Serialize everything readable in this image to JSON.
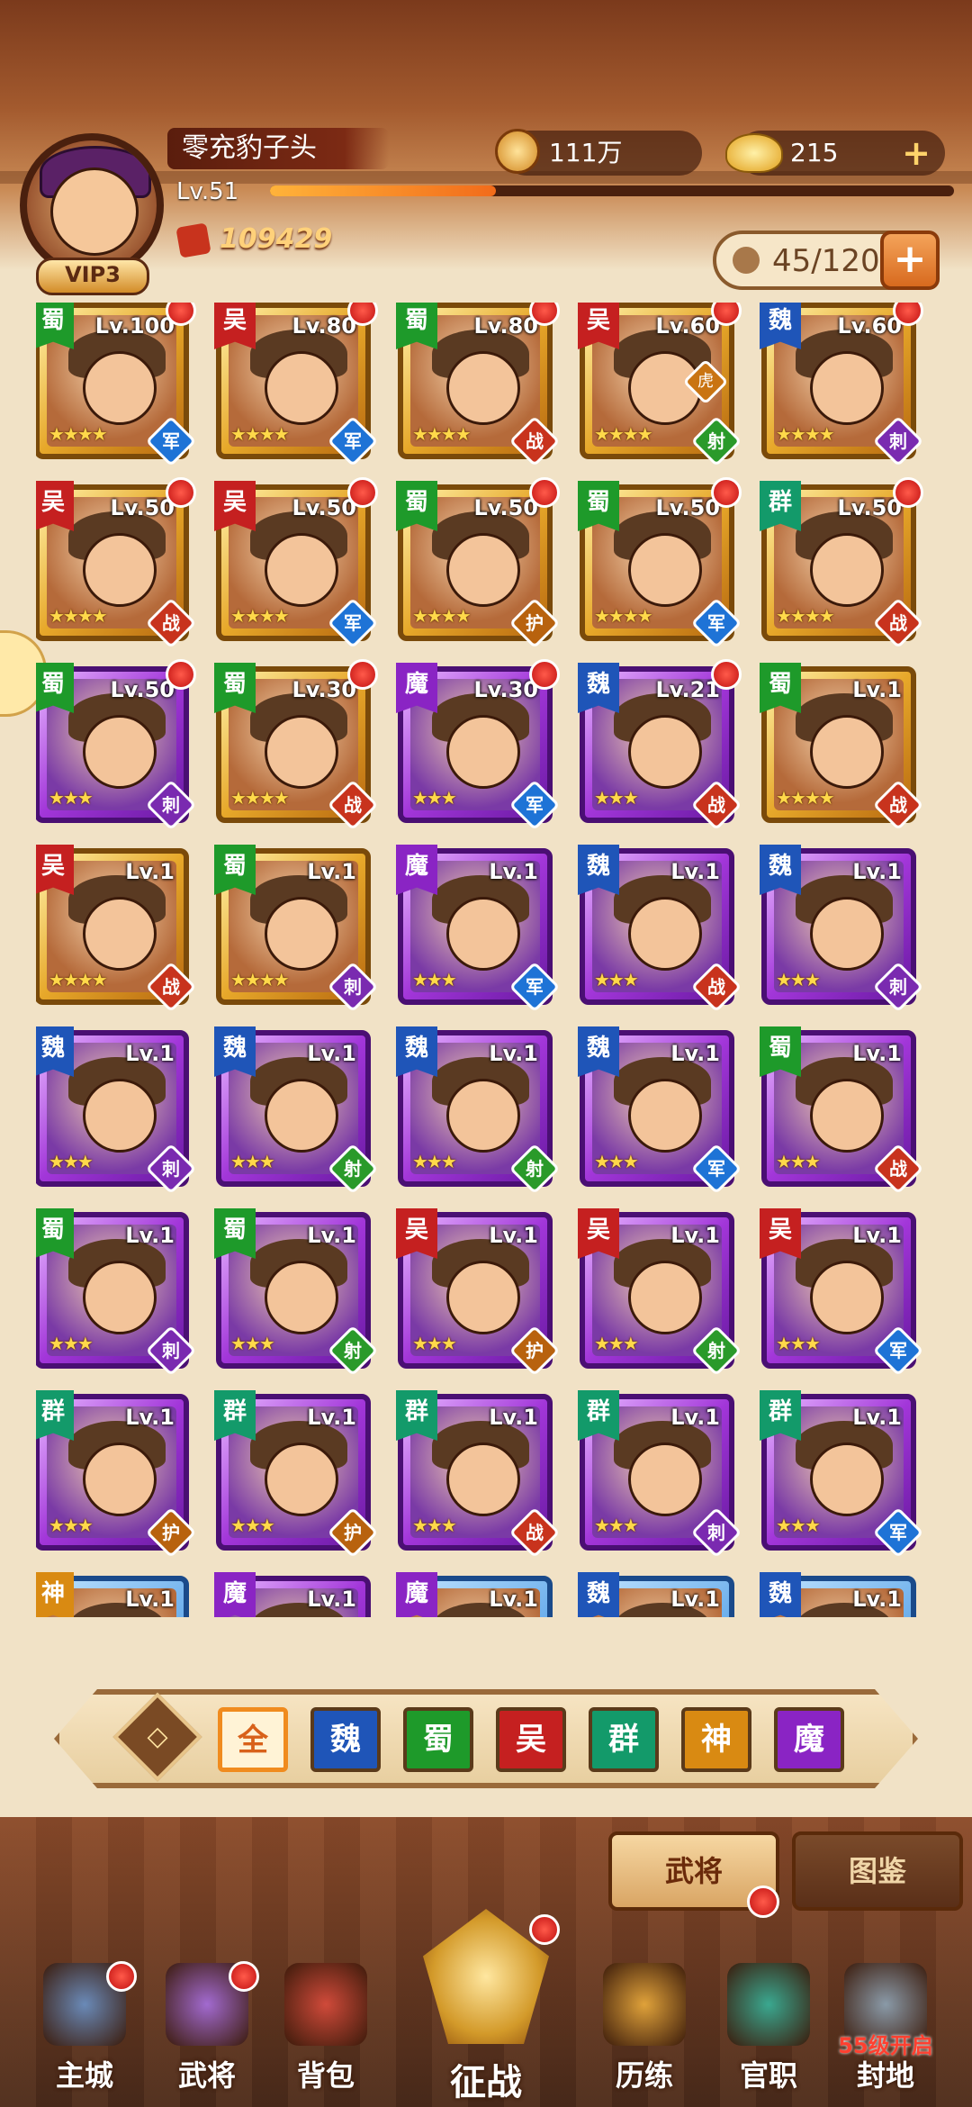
{
  "player": {
    "name": "零充豹子头",
    "level": "Lv.51",
    "vip": "VIP3",
    "power": "109429",
    "exp_fraction": 0.33
  },
  "resources": {
    "coins": "111万",
    "gold": "215"
  },
  "hero_count": "45/120",
  "heroes": [
    {
      "faction": "蜀",
      "level": "Lv.100",
      "stars": "★★★★",
      "role": "军",
      "rarity": "gold",
      "dot": true
    },
    {
      "faction": "吴",
      "level": "Lv.80",
      "stars": "★★★★",
      "role": "军",
      "rarity": "gold",
      "dot": true
    },
    {
      "faction": "蜀",
      "level": "Lv.80",
      "stars": "★★★★",
      "role": "战",
      "rarity": "gold",
      "dot": true
    },
    {
      "faction": "吴",
      "level": "Lv.60",
      "stars": "★★★★",
      "role": "射",
      "extra_role": "虎",
      "rarity": "gold",
      "dot": true
    },
    {
      "faction": "魏",
      "level": "Lv.60",
      "stars": "★★★★",
      "role": "刺",
      "rarity": "gold",
      "dot": true
    },
    {
      "faction": "吴",
      "level": "Lv.50",
      "stars": "★★★★",
      "role": "战",
      "rarity": "gold",
      "dot": true
    },
    {
      "faction": "吴",
      "level": "Lv.50",
      "stars": "★★★★",
      "role": "军",
      "rarity": "gold",
      "dot": true
    },
    {
      "faction": "蜀",
      "level": "Lv.50",
      "stars": "★★★★",
      "role": "护",
      "rarity": "gold",
      "dot": true
    },
    {
      "faction": "蜀",
      "level": "Lv.50",
      "stars": "★★★★",
      "role": "军",
      "rarity": "gold",
      "dot": true
    },
    {
      "faction": "群",
      "level": "Lv.50",
      "stars": "★★★★",
      "role": "战",
      "rarity": "gold",
      "dot": true
    },
    {
      "faction": "蜀",
      "level": "Lv.50",
      "stars": "★★★",
      "role": "刺",
      "rarity": "purple",
      "dot": true
    },
    {
      "faction": "蜀",
      "level": "Lv.30",
      "stars": "★★★★",
      "role": "战",
      "rarity": "gold",
      "dot": true
    },
    {
      "faction": "魔",
      "level": "Lv.30",
      "stars": "★★★",
      "role": "军",
      "rarity": "purple",
      "dot": true
    },
    {
      "faction": "魏",
      "level": "Lv.21",
      "stars": "★★★",
      "role": "战",
      "rarity": "purple",
      "dot": true
    },
    {
      "faction": "蜀",
      "level": "Lv.1",
      "stars": "★★★★",
      "role": "战",
      "rarity": "gold",
      "dot": false
    },
    {
      "faction": "吴",
      "level": "Lv.1",
      "stars": "★★★★",
      "role": "战",
      "rarity": "gold",
      "dot": false
    },
    {
      "faction": "蜀",
      "level": "Lv.1",
      "stars": "★★★★",
      "role": "刺",
      "rarity": "gold",
      "dot": false
    },
    {
      "faction": "魔",
      "level": "Lv.1",
      "stars": "★★★",
      "role": "军",
      "rarity": "purple",
      "dot": false
    },
    {
      "faction": "魏",
      "level": "Lv.1",
      "stars": "★★★",
      "role": "战",
      "rarity": "purple",
      "dot": false
    },
    {
      "faction": "魏",
      "level": "Lv.1",
      "stars": "★★★",
      "role": "刺",
      "rarity": "purple",
      "dot": false
    },
    {
      "faction": "魏",
      "level": "Lv.1",
      "stars": "★★★",
      "role": "刺",
      "rarity": "purple",
      "dot": false
    },
    {
      "faction": "魏",
      "level": "Lv.1",
      "stars": "★★★",
      "role": "射",
      "rarity": "purple",
      "dot": false
    },
    {
      "faction": "魏",
      "level": "Lv.1",
      "stars": "★★★",
      "role": "射",
      "rarity": "purple",
      "dot": false
    },
    {
      "faction": "魏",
      "level": "Lv.1",
      "stars": "★★★",
      "role": "军",
      "rarity": "purple",
      "dot": false
    },
    {
      "faction": "蜀",
      "level": "Lv.1",
      "stars": "★★★",
      "role": "战",
      "rarity": "purple",
      "dot": false
    },
    {
      "faction": "蜀",
      "level": "Lv.1",
      "stars": "★★★",
      "role": "刺",
      "rarity": "purple",
      "dot": false
    },
    {
      "faction": "蜀",
      "level": "Lv.1",
      "stars": "★★★",
      "role": "射",
      "rarity": "purple",
      "dot": false
    },
    {
      "faction": "吴",
      "level": "Lv.1",
      "stars": "★★★",
      "role": "护",
      "rarity": "purple",
      "dot": false
    },
    {
      "faction": "吴",
      "level": "Lv.1",
      "stars": "★★★",
      "role": "射",
      "rarity": "purple",
      "dot": false
    },
    {
      "faction": "吴",
      "level": "Lv.1",
      "stars": "★★★",
      "role": "军",
      "rarity": "purple",
      "dot": false
    },
    {
      "faction": "群",
      "level": "Lv.1",
      "stars": "★★★",
      "role": "护",
      "rarity": "purple",
      "dot": false
    },
    {
      "faction": "群",
      "level": "Lv.1",
      "stars": "★★★",
      "role": "护",
      "rarity": "purple",
      "dot": false
    },
    {
      "faction": "群",
      "level": "Lv.1",
      "stars": "★★★",
      "role": "战",
      "rarity": "purple",
      "dot": false
    },
    {
      "faction": "群",
      "level": "Lv.1",
      "stars": "★★★",
      "role": "刺",
      "rarity": "purple",
      "dot": false
    },
    {
      "faction": "群",
      "level": "Lv.1",
      "stars": "★★★",
      "role": "军",
      "rarity": "purple",
      "dot": false
    },
    {
      "faction": "神",
      "level": "Lv.1",
      "stars": "",
      "role": "",
      "rarity": "blue",
      "dot": false
    },
    {
      "faction": "魔",
      "level": "Lv.1",
      "stars": "",
      "role": "",
      "rarity": "purple",
      "dot": false
    },
    {
      "faction": "魔",
      "level": "Lv.1",
      "stars": "",
      "role": "",
      "rarity": "blue",
      "dot": false
    },
    {
      "faction": "魏",
      "level": "Lv.1",
      "stars": "",
      "role": "",
      "rarity": "blue",
      "dot": false
    },
    {
      "faction": "魏",
      "level": "Lv.1",
      "stars": "",
      "role": "",
      "rarity": "blue",
      "dot": false
    }
  ],
  "filter_tabs": [
    {
      "label": "全",
      "active": true,
      "color": "#fff3d6"
    },
    {
      "label": "魏",
      "active": false,
      "color": "#1f55b8"
    },
    {
      "label": "蜀",
      "active": false,
      "color": "#1e9a2a"
    },
    {
      "label": "吴",
      "active": false,
      "color": "#c52020"
    },
    {
      "label": "群",
      "active": false,
      "color": "#139a6a"
    },
    {
      "label": "神",
      "active": false,
      "color": "#d98a12"
    },
    {
      "label": "魔",
      "active": false,
      "color": "#8a24c4"
    }
  ],
  "sub_tabs": {
    "heroes": "武将",
    "codex": "图鉴"
  },
  "bottom_nav": [
    {
      "label": "主城",
      "icon": "city-icon",
      "dot": true
    },
    {
      "label": "武将",
      "icon": "hero-icon",
      "dot": true
    },
    {
      "label": "背包",
      "icon": "bag-icon",
      "dot": false
    },
    {
      "label": "历练",
      "icon": "training-icon",
      "dot": false
    },
    {
      "label": "官职",
      "icon": "rank-icon",
      "dot": false
    },
    {
      "label": "封地",
      "icon": "fief-icon",
      "dot": false,
      "locked": "55级开启"
    }
  ],
  "center_nav": {
    "label": "征战",
    "icon": "battle-icon",
    "dot": true
  },
  "colors": {
    "faction_shu": "#1e9a2a",
    "faction_wu": "#c52020",
    "faction_wei": "#1f55b8",
    "faction_qun": "#139a6a",
    "faction_mo": "#8a24c4",
    "faction_shen": "#d98a12",
    "role_jun": "#1e73d6",
    "role_zhan": "#c8331d",
    "role_ci": "#7a2ab0",
    "role_she": "#2a9a2a",
    "role_hu": "#b8620e"
  }
}
